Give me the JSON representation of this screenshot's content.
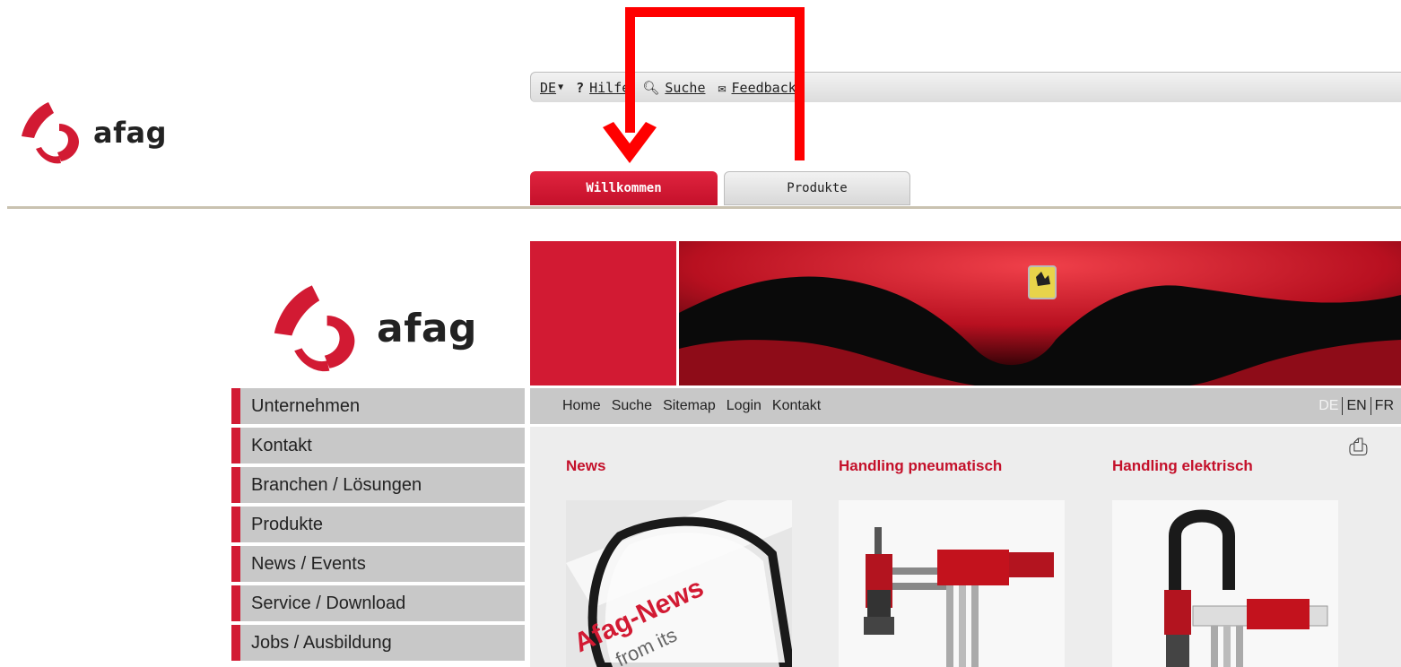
{
  "header": {
    "logo_text": "afag",
    "util_links": [
      {
        "label": "DE",
        "icon": "dropdown-arrow-icon"
      },
      {
        "label": "Hilfe",
        "icon": "help-icon"
      },
      {
        "label": "Suche",
        "icon": "magnifier-icon"
      },
      {
        "label": "Feedback",
        "icon": "mail-icon"
      }
    ],
    "tabs": [
      {
        "label": "Willkommen",
        "active": true
      },
      {
        "label": "Produkte",
        "active": false
      }
    ]
  },
  "site": {
    "logo_text": "afag",
    "subnav": [
      "Home",
      "Suche",
      "Sitemap",
      "Login",
      "Kontakt"
    ],
    "languages": {
      "current": "DE",
      "others": [
        "EN",
        "FR"
      ]
    },
    "leftnav": [
      "Unternehmen",
      "Kontakt",
      "Branchen / Lösungen",
      "Produkte",
      "News / Events",
      "Service / Download",
      "Jobs / Ausbildung"
    ],
    "columns": [
      {
        "title": "News",
        "image_text": "Afag-News"
      },
      {
        "title": "Handling pneumatisch"
      },
      {
        "title": "Handling elektrisch"
      }
    ]
  },
  "colors": {
    "brand_red": "#d21a33",
    "nav_gray": "#c8c8c8",
    "annotation_red": "#ff0000"
  }
}
